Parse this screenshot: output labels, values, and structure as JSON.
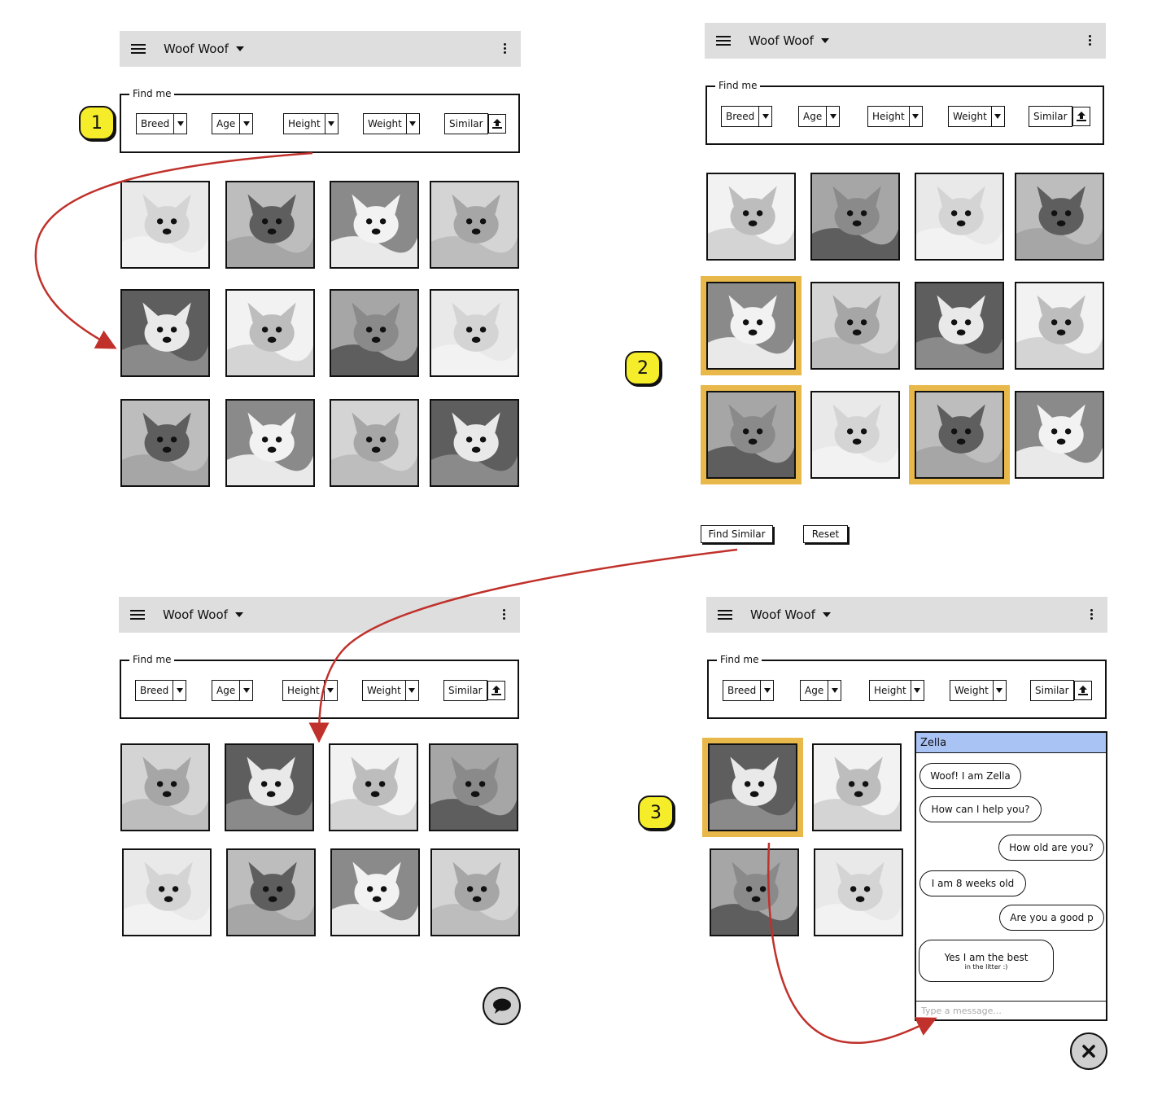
{
  "app": {
    "title": "Woof Woof"
  },
  "find": {
    "legend": "Find me",
    "filters": [
      "Breed",
      "Age",
      "Height",
      "Weight",
      "Similar"
    ]
  },
  "steps": [
    "1",
    "2",
    "3"
  ],
  "actions": {
    "find_similar": "Find Similar",
    "reset": "Reset"
  },
  "chat": {
    "name": "Zella",
    "messages": [
      {
        "from": "dog",
        "text": "Woof! I am Zella"
      },
      {
        "from": "dog",
        "text": "How can I help you?"
      },
      {
        "from": "user",
        "text": "How old are you?"
      },
      {
        "from": "dog",
        "text": "I am 8 weeks old"
      },
      {
        "from": "user",
        "text": "Are you a good p"
      },
      {
        "from": "dog",
        "text": "Yes I am the best",
        "subtext": "in the litter :)"
      }
    ],
    "input_placeholder": "Type a message..."
  },
  "icons": {
    "menu": "hamburger-menu-icon",
    "dropdown": "caret-down-icon",
    "more": "kebab-more-icon",
    "upload": "upload-icon",
    "chat": "chat-bubble-icon",
    "close": "close-x-icon"
  },
  "colors": {
    "toolbar": "#dedede",
    "selection": "#e8b94a",
    "badge": "#f5ec2a",
    "chat_header": "#a9c3f5",
    "arrow": "#c0312b"
  }
}
